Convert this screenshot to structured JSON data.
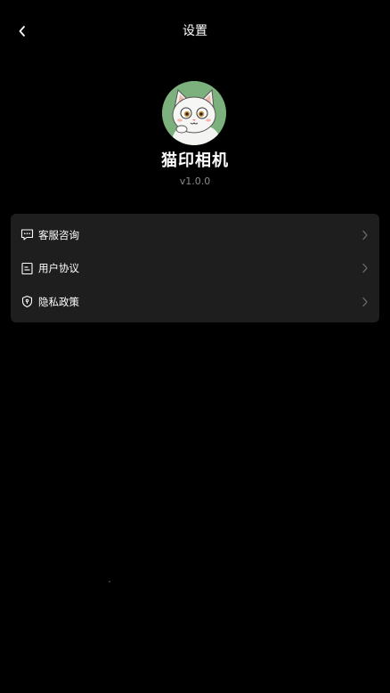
{
  "header": {
    "title": "设置",
    "back_icon": "chevron-left-icon"
  },
  "profile": {
    "app_name": "猫印相机",
    "version": "v1.0.0",
    "avatar": "cat-avatar",
    "avatar_bg": "#7cb07c"
  },
  "menu": {
    "items": [
      {
        "label": "客服咨询",
        "icon": "chat-icon"
      },
      {
        "label": "用户协议",
        "icon": "document-icon"
      },
      {
        "label": "隐私政策",
        "icon": "shield-icon"
      }
    ]
  },
  "colors": {
    "background": "#000000",
    "card": "#1e1e1e",
    "text": "#ffffff",
    "muted": "#8a8a8a"
  }
}
